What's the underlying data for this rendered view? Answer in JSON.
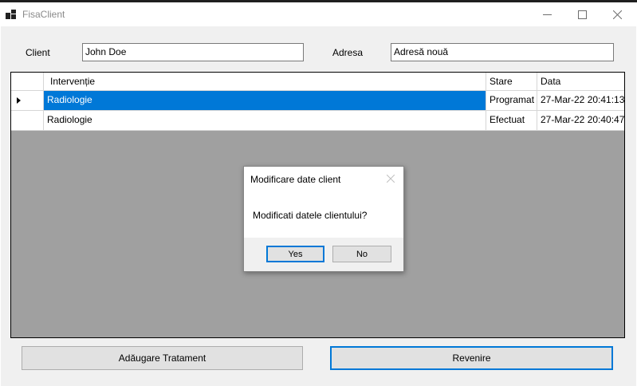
{
  "window": {
    "title": "FisaClient",
    "controls": {
      "minimize_icon": "minimize-icon",
      "maximize_icon": "maximize-icon",
      "close_icon": "close-icon"
    }
  },
  "form": {
    "client_label": "Client",
    "client_value": "John Doe",
    "adresa_label": "Adresa",
    "adresa_value": "Adresă nouă"
  },
  "grid": {
    "columns": [
      "",
      "Intervenție",
      "Stare",
      "Data"
    ],
    "rows": [
      {
        "interventie": "Radiologie",
        "stare": "Programat",
        "data": "27-Mar-22 20:41:13",
        "selected": true
      },
      {
        "interventie": "Radiologie",
        "stare": "Efectuat",
        "data": "27-Mar-22 20:40:47",
        "selected": false
      }
    ]
  },
  "buttons": {
    "add_label": "Adăugare Tratament",
    "back_label": "Revenire"
  },
  "dialog": {
    "title": "Modificare date client",
    "message": "Modificati datele clientului?",
    "yes_label": "Yes",
    "no_label": "No"
  },
  "colors": {
    "accent": "#0078d7",
    "grid_background": "#a0a0a0",
    "form_background": "#f0f0f0"
  }
}
